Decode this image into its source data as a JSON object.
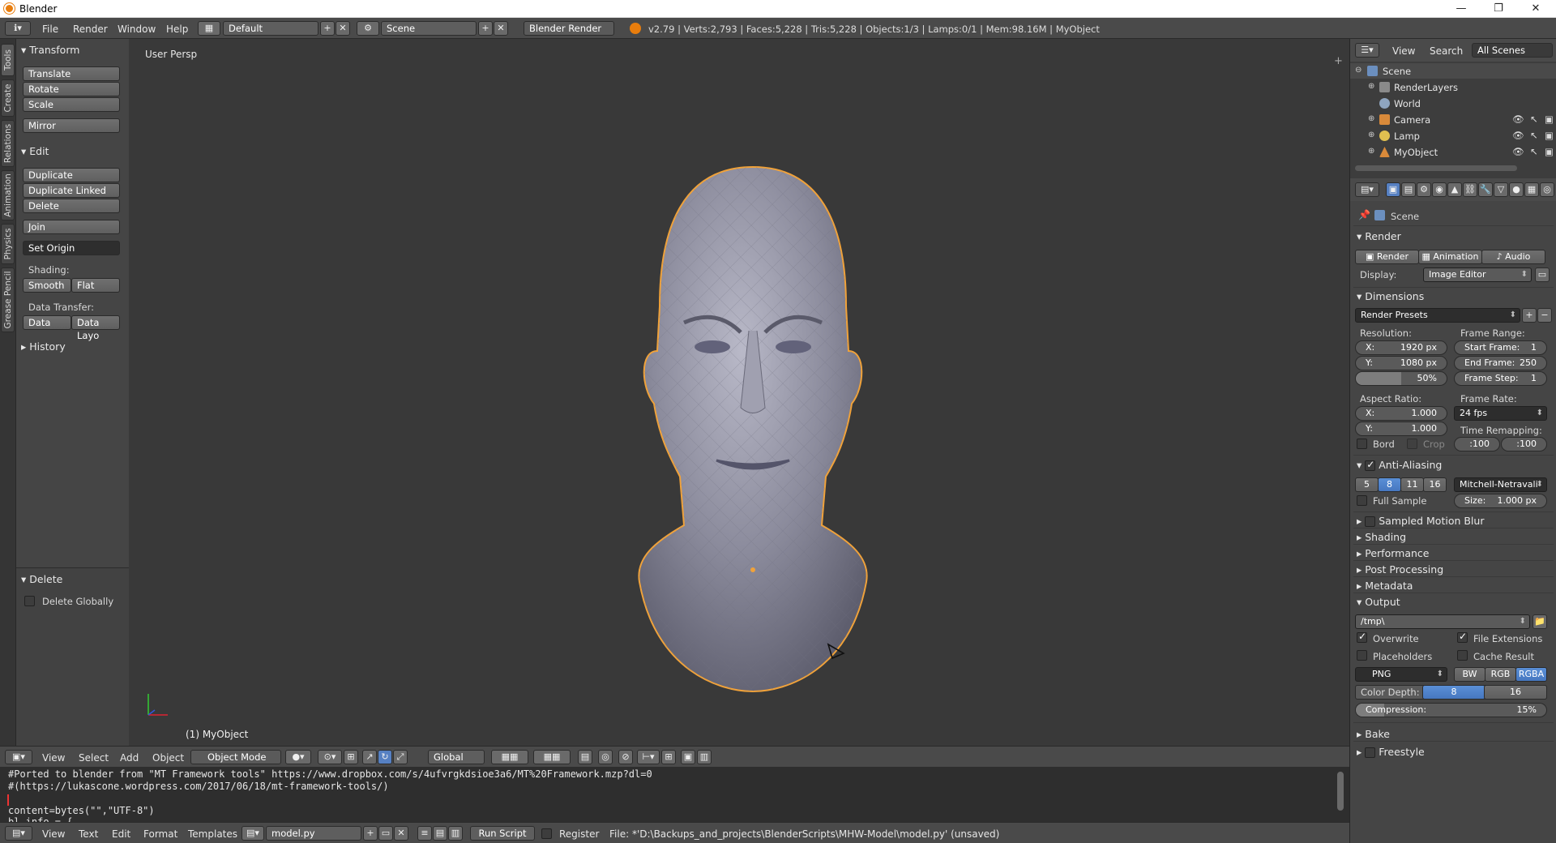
{
  "window": {
    "title": "Blender",
    "controls": [
      "—",
      "❐",
      "✕"
    ]
  },
  "info_header": {
    "menus": [
      "File",
      "Render",
      "Window",
      "Help"
    ],
    "layout": "Default",
    "scene": "Scene",
    "engine": "Blender Render",
    "stats": "v2.79 | Verts:2,793 | Faces:5,228 | Tris:5,228 | Objects:1/3 | Lamps:0/1 | Mem:98.16M | MyObject"
  },
  "tool_tabs": [
    "Tools",
    "Create",
    "Relations",
    "Animation",
    "Physics",
    "Grease Pencil"
  ],
  "toolshelf": {
    "transform": {
      "title": "Transform",
      "buttons": [
        "Translate",
        "Rotate",
        "Scale",
        "Mirror"
      ]
    },
    "edit": {
      "title": "Edit",
      "buttons": [
        "Duplicate",
        "Duplicate Linked",
        "Delete",
        "Join"
      ],
      "set_origin": "Set Origin",
      "shading_label": "Shading:",
      "smooth": "Smooth",
      "flat": "Flat",
      "data_transfer_label": "Data Transfer:",
      "data": "Data",
      "data_layout": "Data Layo"
    },
    "history": "History",
    "operator": {
      "title": "Delete",
      "delete_globally": "Delete Globally"
    }
  },
  "viewport": {
    "view_name": "User Persp",
    "object_label": "(1) MyObject"
  },
  "viewport_header": {
    "menus": [
      "View",
      "Select",
      "Add",
      "Object"
    ],
    "mode": "Object Mode",
    "orientation": "Global"
  },
  "text_editor": {
    "lines": [
      "#Ported to blender from \"MT Framework tools\" https://www.dropbox.com/s/4ufvrgkdsioe3a6/MT%20Framework.mzp?dl=0",
      "#(https://lukascone.wordpress.com/2017/06/18/mt-framework-tools/)",
      "",
      "content=bytes(\"\",\"UTF-8\")",
      "bl_info = {"
    ],
    "menus": [
      "View",
      "Text",
      "Edit",
      "Format",
      "Templates"
    ],
    "file": "model.py",
    "run_script": "Run Script",
    "register": "Register",
    "file_path": "File: *'D:\\Backups_and_projects\\BlenderScripts\\MHW-Model\\model.py' (unsaved)"
  },
  "outliner": {
    "menus": [
      "View",
      "Search"
    ],
    "filter": "All Scenes",
    "items": [
      {
        "name": "Scene",
        "icon": "scene-icon"
      },
      {
        "name": "RenderLayers",
        "icon": "renderlayers-icon"
      },
      {
        "name": "World",
        "icon": "world-icon"
      },
      {
        "name": "Camera",
        "icon": "camera-icon"
      },
      {
        "name": "Lamp",
        "icon": "lamp-icon"
      },
      {
        "name": "MyObject",
        "icon": "mesh-icon"
      }
    ]
  },
  "properties": {
    "context": "Scene",
    "render": {
      "title": "Render",
      "render_btn": "Render",
      "animation_btn": "Animation",
      "audio_btn": "Audio",
      "display_label": "Display:",
      "display": "Image Editor"
    },
    "dimensions": {
      "title": "Dimensions",
      "presets": "Render Presets",
      "resolution_label": "Resolution:",
      "res_x_k": "X:",
      "res_x": "1920 px",
      "res_y_k": "Y:",
      "res_y": "1080 px",
      "res_pct": "50%",
      "frame_range_label": "Frame Range:",
      "start_k": "Start Frame:",
      "start": "1",
      "end_k": "End Frame:",
      "end": "250",
      "step_k": "Frame Step:",
      "step": "1",
      "aspect_label": "Aspect Ratio:",
      "asp_x": "1.000",
      "asp_y": "1.000",
      "frame_rate_label": "Frame Rate:",
      "frame_rate": "24 fps",
      "time_remap_label": "Time Remapping:",
      "remap_old": ":100",
      "remap_new": ":100",
      "bord": "Bord",
      "crop": "Crop"
    },
    "anti_aliasing": {
      "title": "Anti-Aliasing",
      "samples": [
        "5",
        "8",
        "11",
        "16"
      ],
      "filter": "Mitchell-Netravali",
      "full_sample": "Full Sample",
      "size_k": "Size:",
      "size": "1.000 px"
    },
    "collapsed": [
      "Sampled Motion Blur",
      "Shading",
      "Performance",
      "Post Processing",
      "Metadata"
    ],
    "output": {
      "title": "Output",
      "path": "/tmp\\",
      "overwrite": "Overwrite",
      "file_extensions": "File Extensions",
      "placeholders": "Placeholders",
      "cache_result": "Cache Result",
      "format": "PNG",
      "bw": "BW",
      "rgb": "RGB",
      "rgba": "RGBA",
      "color_depth_label": "Color Depth:",
      "depth_8": "8",
      "depth_16": "16",
      "compression_label": "Compression:",
      "compression": "15%"
    },
    "bake": "Bake",
    "freestyle": "Freestyle"
  }
}
